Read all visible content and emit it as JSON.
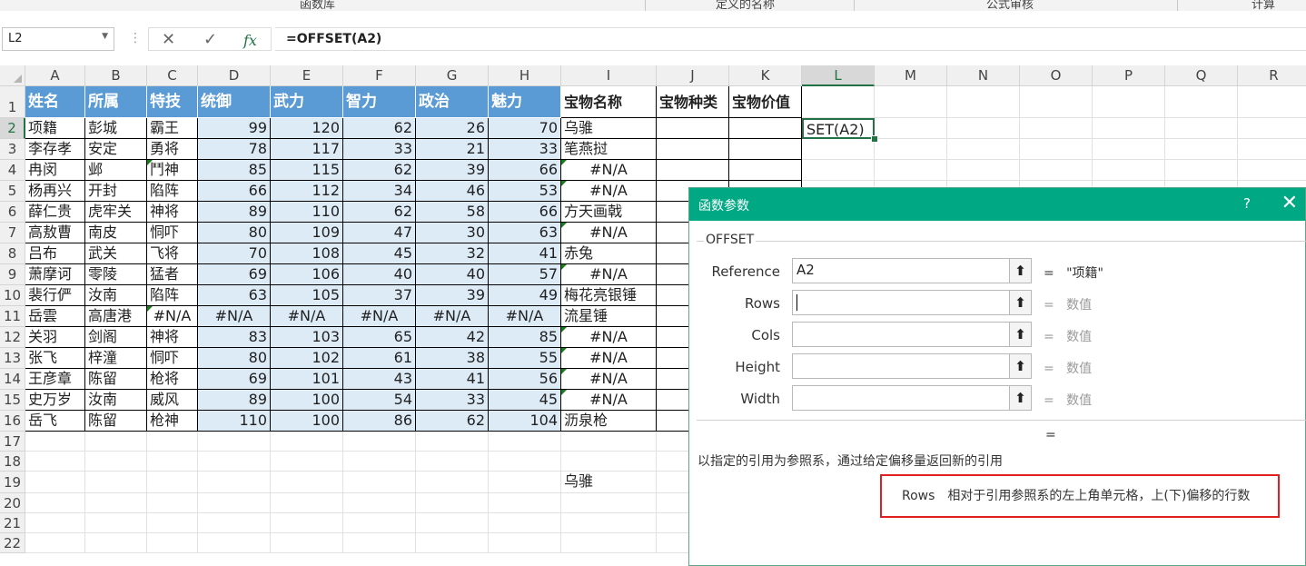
{
  "ribbon": {
    "groups": [
      "函数库",
      "定义的名称",
      "公式审核",
      "计算"
    ]
  },
  "formula_bar": {
    "name_box": "L2",
    "formula": "=OFFSET(A2)",
    "cancel_icon": "✕",
    "enter_icon": "✓",
    "fx_icon": "fx"
  },
  "columns": [
    "A",
    "B",
    "C",
    "D",
    "E",
    "F",
    "G",
    "H",
    "I",
    "J",
    "K",
    "L",
    "M",
    "N",
    "O",
    "P",
    "Q",
    "R"
  ],
  "rows": [
    "1",
    "2",
    "3",
    "4",
    "5",
    "6",
    "7",
    "8",
    "9",
    "10",
    "11",
    "12",
    "13",
    "14",
    "15",
    "16",
    "17",
    "18",
    "19",
    "20",
    "21",
    "22"
  ],
  "header": [
    "姓名",
    "所属",
    "特技",
    "统御",
    "武力",
    "智力",
    "政治",
    "魅力",
    "宝物名称",
    "宝物种类",
    "宝物价值"
  ],
  "data": [
    [
      "项籍",
      "彭城",
      "霸王",
      "99",
      "120",
      "62",
      "26",
      "70",
      "乌骓"
    ],
    [
      "李存孝",
      "安定",
      "勇将",
      "78",
      "117",
      "33",
      "21",
      "33",
      "笔燕挝"
    ],
    [
      "冉闵",
      "邺",
      "鬥神",
      "85",
      "115",
      "62",
      "39",
      "66",
      "#N/A"
    ],
    [
      "杨再兴",
      "开封",
      "陷阵",
      "66",
      "112",
      "34",
      "46",
      "53",
      "#N/A"
    ],
    [
      "薛仁贵",
      "虎牢关",
      "神将",
      "89",
      "110",
      "62",
      "58",
      "66",
      "方天画戟"
    ],
    [
      "高敖曹",
      "南皮",
      "恫吓",
      "80",
      "109",
      "47",
      "30",
      "63",
      "#N/A"
    ],
    [
      "吕布",
      "武关",
      "飞将",
      "70",
      "108",
      "45",
      "32",
      "41",
      "赤兔"
    ],
    [
      "萧摩诃",
      "零陵",
      "猛者",
      "69",
      "106",
      "40",
      "40",
      "57",
      "#N/A"
    ],
    [
      "裴行俨",
      "汝南",
      "陷阵",
      "63",
      "105",
      "37",
      "39",
      "49",
      "梅花亮银锤"
    ],
    [
      "岳雲",
      "高唐港",
      "#N/A",
      "#N/A",
      "#N/A",
      "#N/A",
      "#N/A",
      "#N/A",
      "流星锤"
    ],
    [
      "关羽",
      "剑阁",
      "神将",
      "83",
      "103",
      "65",
      "42",
      "85",
      "#N/A"
    ],
    [
      "张飞",
      "梓潼",
      "恫吓",
      "80",
      "102",
      "61",
      "38",
      "55",
      "#N/A"
    ],
    [
      "王彦章",
      "陈留",
      "枪将",
      "69",
      "101",
      "43",
      "41",
      "56",
      "#N/A"
    ],
    [
      "史万岁",
      "汝南",
      "威风",
      "89",
      "100",
      "54",
      "33",
      "45",
      "#N/A"
    ],
    [
      "岳飞",
      "陈留",
      "枪神",
      "110",
      "100",
      "86",
      "62",
      "104",
      "沥泉枪"
    ]
  ],
  "cell_L2": "SET(A2)",
  "cell_I19": "乌骓",
  "dialog": {
    "title": "函数参数",
    "help": "?",
    "close": "✕",
    "function_name": "OFFSET",
    "params": [
      {
        "label": "Reference",
        "value": "A2",
        "result": "\"项籍\""
      },
      {
        "label": "Rows",
        "value": "",
        "result": "数值"
      },
      {
        "label": "Cols",
        "value": "",
        "result": "数值"
      },
      {
        "label": "Height",
        "value": "",
        "result": "数值"
      },
      {
        "label": "Width",
        "value": "",
        "result": "数值"
      }
    ],
    "total_result": "=",
    "description": "以指定的引用为参照系，通过给定偏移量返回新的引用",
    "param_name": "Rows",
    "param_description": "相对于引用参照系的左上角单元格，上(下)偏移的行数"
  }
}
